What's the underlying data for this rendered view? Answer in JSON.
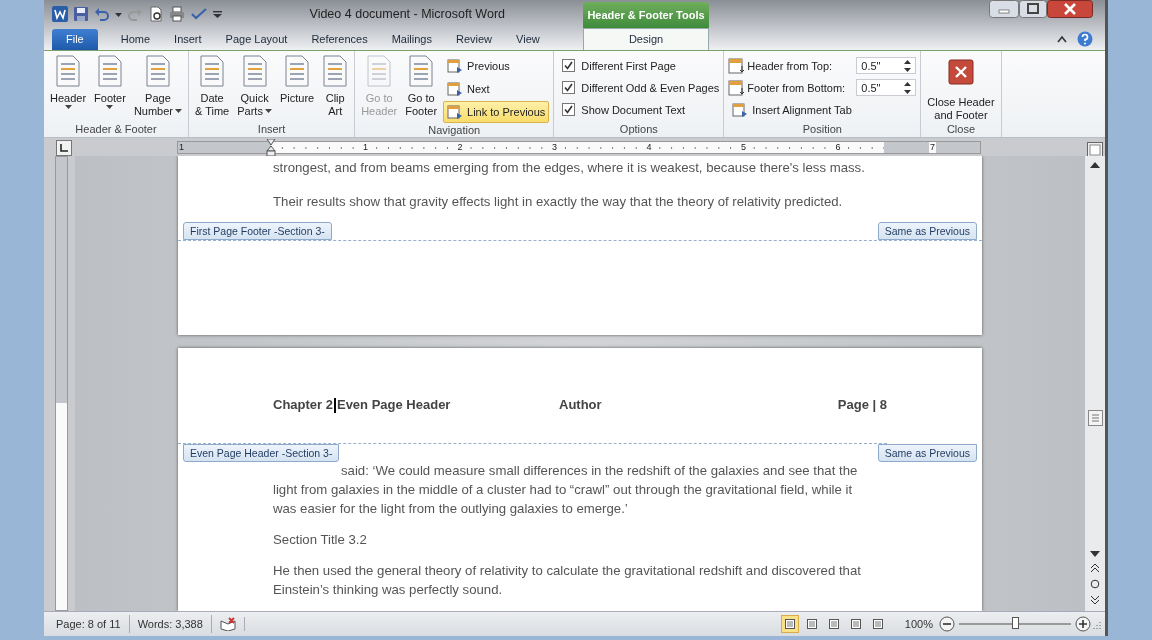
{
  "window": {
    "title": "Video 4 document - Microsoft Word",
    "contextual_title": "Header & Footer Tools"
  },
  "tabs": [
    {
      "label": "File",
      "kind": "file",
      "selected": false
    },
    {
      "label": "Home",
      "kind": "normal",
      "selected": false
    },
    {
      "label": "Insert",
      "kind": "normal",
      "selected": false
    },
    {
      "label": "Page Layout",
      "kind": "normal",
      "selected": false
    },
    {
      "label": "References",
      "kind": "normal",
      "selected": false
    },
    {
      "label": "Mailings",
      "kind": "normal",
      "selected": false
    },
    {
      "label": "Review",
      "kind": "normal",
      "selected": false
    },
    {
      "label": "View",
      "kind": "normal",
      "selected": false
    },
    {
      "label": "Design",
      "kind": "contextual",
      "selected": true
    }
  ],
  "ribbon": {
    "groups": [
      {
        "label": "Header & Footer",
        "items": [
          {
            "kind": "large",
            "label": [
              "Header"
            ],
            "dropdown": true
          },
          {
            "kind": "large",
            "label": [
              "Footer"
            ],
            "dropdown": true
          },
          {
            "kind": "large",
            "label": [
              "Page",
              "Number"
            ],
            "dropdown": true
          }
        ]
      },
      {
        "label": "Insert",
        "items": [
          {
            "kind": "large",
            "label": [
              "Date",
              "& Time"
            ]
          },
          {
            "kind": "large",
            "label": [
              "Quick",
              "Parts"
            ],
            "dropdown": true
          },
          {
            "kind": "large",
            "label": [
              "Picture"
            ]
          },
          {
            "kind": "large",
            "label": [
              "Clip",
              "Art"
            ]
          }
        ]
      },
      {
        "label": "Navigation",
        "items": [
          {
            "kind": "large",
            "label": [
              "Go to",
              "Header"
            ],
            "disabled": true
          },
          {
            "kind": "large",
            "label": [
              "Go to",
              "Footer"
            ],
            "disabled": false
          },
          {
            "kind": "small",
            "label": "Previous",
            "on": false
          },
          {
            "kind": "small",
            "label": "Next",
            "on": false
          },
          {
            "kind": "small",
            "label": "Link to Previous",
            "on": true
          }
        ]
      },
      {
        "label": "Options",
        "items": [
          {
            "kind": "check",
            "label": "Different First Page",
            "checked": true
          },
          {
            "kind": "check",
            "label": "Different Odd & Even Pages",
            "checked": true
          },
          {
            "kind": "check",
            "label": "Show Document Text",
            "checked": true
          }
        ]
      },
      {
        "label": "Position",
        "items": [
          {
            "kind": "spin",
            "label": "Header from Top:",
            "value": "0.5\""
          },
          {
            "kind": "spin",
            "label": "Footer from Bottom:",
            "value": "0.5\""
          },
          {
            "kind": "small",
            "label": "Insert Alignment Tab",
            "on": false
          }
        ]
      },
      {
        "label": "Close",
        "items": [
          {
            "kind": "close",
            "label": [
              "Close Header",
              "and Footer"
            ]
          }
        ]
      }
    ]
  },
  "ruler": {
    "numbers": [
      "1",
      "1",
      "2",
      "3",
      "4",
      "5",
      "6",
      "7"
    ]
  },
  "pages": [
    {
      "kind": "footer_end",
      "paragraphs": [
        {
          "kind": "body",
          "text": "strongest, and from beams emerging from the edges, where it is weakest, because there's less mass."
        },
        {
          "kind": "body",
          "text": "Their results show that gravity effects light in exactly the way that the theory of relativity predicted."
        }
      ],
      "section_tag": "First Page Footer -Section 3-",
      "same_tag": "Same as Previous"
    },
    {
      "kind": "header_start",
      "header": {
        "left": "Chapter 2",
        "left_after_cursor": "Even Page Header",
        "center": "Author",
        "right": "Page | 8"
      },
      "section_tag": "Even Page Header -Section 3-",
      "same_tag": "Same as Previous",
      "paragraphs": [
        {
          "kind": "continued",
          "text": "said: ‘We could measure small differences in the redshift of the galaxies and see that the light from galaxies in the middle of a cluster had to “crawl” out through the gravitational field, while it was easier for the light from the outlying galaxies to emerge.’"
        },
        {
          "kind": "body",
          "text": "Section Title 3.2"
        },
        {
          "kind": "body",
          "text": "He then used the general theory of relativity to calculate the gravitational redshift and discovered that Einstein’s thinking was perfectly sound."
        }
      ]
    }
  ],
  "status_bar": {
    "page": "Page: 8 of 11",
    "words": "Words: 3,388",
    "views": [
      {
        "selected": true
      },
      {
        "selected": false
      },
      {
        "selected": false
      },
      {
        "selected": false
      },
      {
        "selected": false
      }
    ],
    "zoom": "100%",
    "zoom_slider": {
      "level": 0.5
    }
  }
}
